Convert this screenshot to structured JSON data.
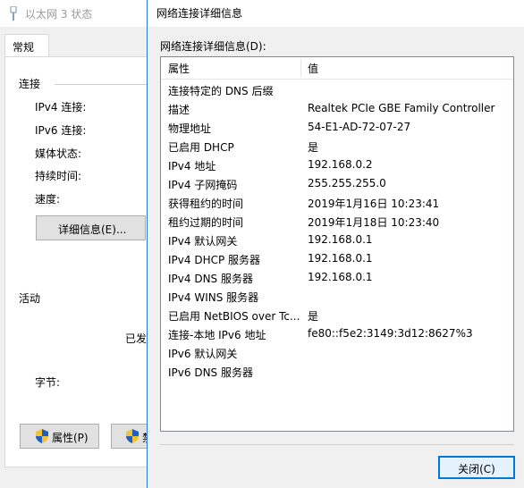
{
  "status_window": {
    "title": "以太网 3 状态",
    "tab_general": "常规",
    "section_connection": "连接",
    "ipv4_conn": "IPv4 连接:",
    "ipv6_conn": "IPv6 连接:",
    "media_state": "媒体状态:",
    "duration": "持续时间:",
    "speed": "速度:",
    "details_button": "详细信息(E)...",
    "section_activity": "活动",
    "sent": "已发",
    "bytes": "字节:",
    "properties_button": "属性(P)",
    "disable_button_partial": "禁"
  },
  "details_dialog": {
    "title": "网络连接详细信息",
    "list_label": "网络连接详细信息(D):",
    "columns": {
      "property": "属性",
      "value": "值"
    },
    "rows": [
      {
        "property": "连接特定的 DNS 后缀",
        "value": ""
      },
      {
        "property": "描述",
        "value": "Realtek PCIe GBE Family Controller"
      },
      {
        "property": "物理地址",
        "value": "54-E1-AD-72-07-27"
      },
      {
        "property": "已启用 DHCP",
        "value": "是"
      },
      {
        "property": "IPv4 地址",
        "value": "192.168.0.2"
      },
      {
        "property": "IPv4 子网掩码",
        "value": "255.255.255.0"
      },
      {
        "property": "获得租约的时间",
        "value": "2019年1月16日 10:23:41"
      },
      {
        "property": "租约过期的时间",
        "value": "2019年1月18日 10:23:40"
      },
      {
        "property": "IPv4 默认网关",
        "value": "192.168.0.1"
      },
      {
        "property": "IPv4 DHCP 服务器",
        "value": "192.168.0.1"
      },
      {
        "property": "IPv4 DNS 服务器",
        "value": "192.168.0.1"
      },
      {
        "property": "IPv4 WINS 服务器",
        "value": ""
      },
      {
        "property": "已启用 NetBIOS over Tc...",
        "value": "是"
      },
      {
        "property": "连接-本地 IPv6 地址",
        "value": "fe80::f5e2:3149:3d12:8627%3"
      },
      {
        "property": "IPv6 默认网关",
        "value": ""
      },
      {
        "property": "IPv6 DNS 服务器",
        "value": ""
      }
    ],
    "close_button": "关闭(C)"
  },
  "colors": {
    "accent": "#0078d7",
    "window_bg": "#f0f0f0",
    "border": "#828790"
  }
}
